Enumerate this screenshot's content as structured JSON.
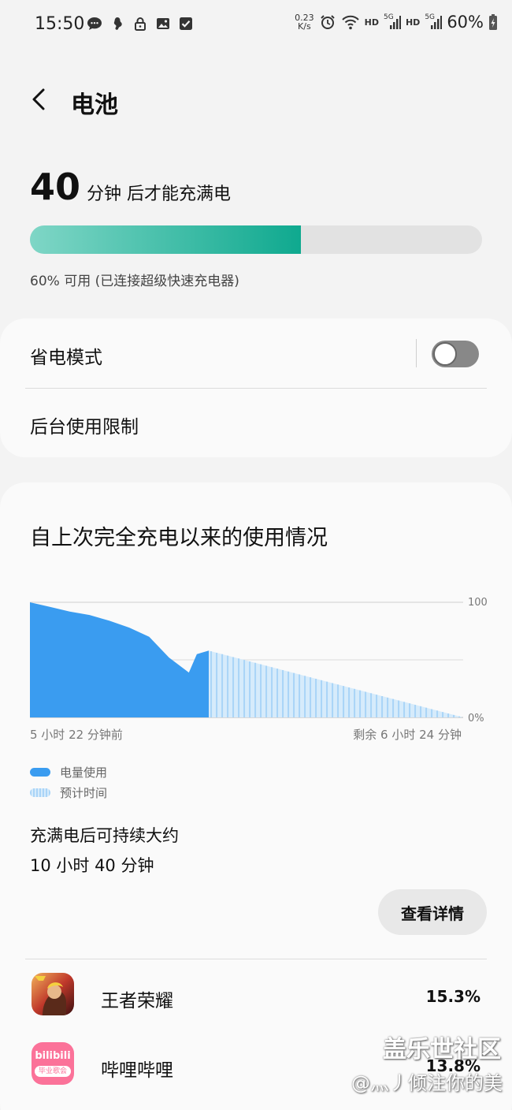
{
  "status_bar": {
    "time": "15:50",
    "net_speed_value": "0.23",
    "net_speed_unit": "K/s",
    "hd1": "HD",
    "hd2": "HD",
    "sig1": "5G",
    "sig2": "5G",
    "battery_percent": "60%",
    "left_icons": [
      "message-icon",
      "app-notify-icon",
      "lock-icon",
      "image-icon",
      "check-icon"
    ],
    "right_icons": [
      "alarm-icon",
      "wifi-icon",
      "signal-icon",
      "signal-icon",
      "battery-charging-icon"
    ]
  },
  "header": {
    "title": "电池",
    "back_icon": "chevron-left-icon"
  },
  "charge": {
    "minutes": "40",
    "text": "分钟 后才能充满电",
    "progress_fraction": 0.6,
    "status": "60% 可用 (已连接超级快速充电器)",
    "bar_color_start": "#7fd6c6",
    "bar_color_end": "#0fa98f"
  },
  "settings": {
    "power_saving_label": "省电模式",
    "power_saving_on": false,
    "background_limits_label": "后台使用限制"
  },
  "usage": {
    "title": "自上次完全充电以来的使用情况",
    "legend_used": "电量使用",
    "legend_estimated": "预计时间",
    "estimate_label": "充满电后可持续大约",
    "estimate_value": "10 小时 40 分钟",
    "details_button": "查看详情"
  },
  "chart_data": {
    "type": "area",
    "ylim": [
      0,
      100
    ],
    "y_tick_labels": [
      "100",
      "0%"
    ],
    "x_tick_labels": [
      "5 小时 22 分钟前",
      "剩余 6 小时 24 分钟"
    ],
    "grid": true,
    "series": [
      {
        "name": "电量使用",
        "color": "#3a9cf0",
        "x": [
          0,
          0.5,
          1.0,
          1.5,
          2.0,
          2.5,
          3.0,
          3.5,
          4.0,
          4.2,
          4.5
        ],
        "values": [
          100,
          96,
          92,
          89,
          84,
          78,
          70,
          52,
          39,
          55,
          58
        ]
      },
      {
        "name": "预计时间",
        "color": "#a9d4f7",
        "x": [
          4.5,
          10.9
        ],
        "values": [
          58,
          0
        ]
      }
    ]
  },
  "apps": [
    {
      "name": "王者荣耀",
      "percent": "15.3%",
      "icon": "honor-of-kings-icon",
      "icon_color": "#c0392b"
    },
    {
      "name": "哔哩哔哩",
      "percent": "13.8%",
      "icon": "bilibili-icon",
      "icon_color": "#fb7299",
      "icon_text": "bilibili",
      "icon_subtext": "毕业歌会"
    }
  ],
  "watermark": {
    "line1": "盖乐世社区",
    "line2": "@灬丿倾注你的美"
  }
}
